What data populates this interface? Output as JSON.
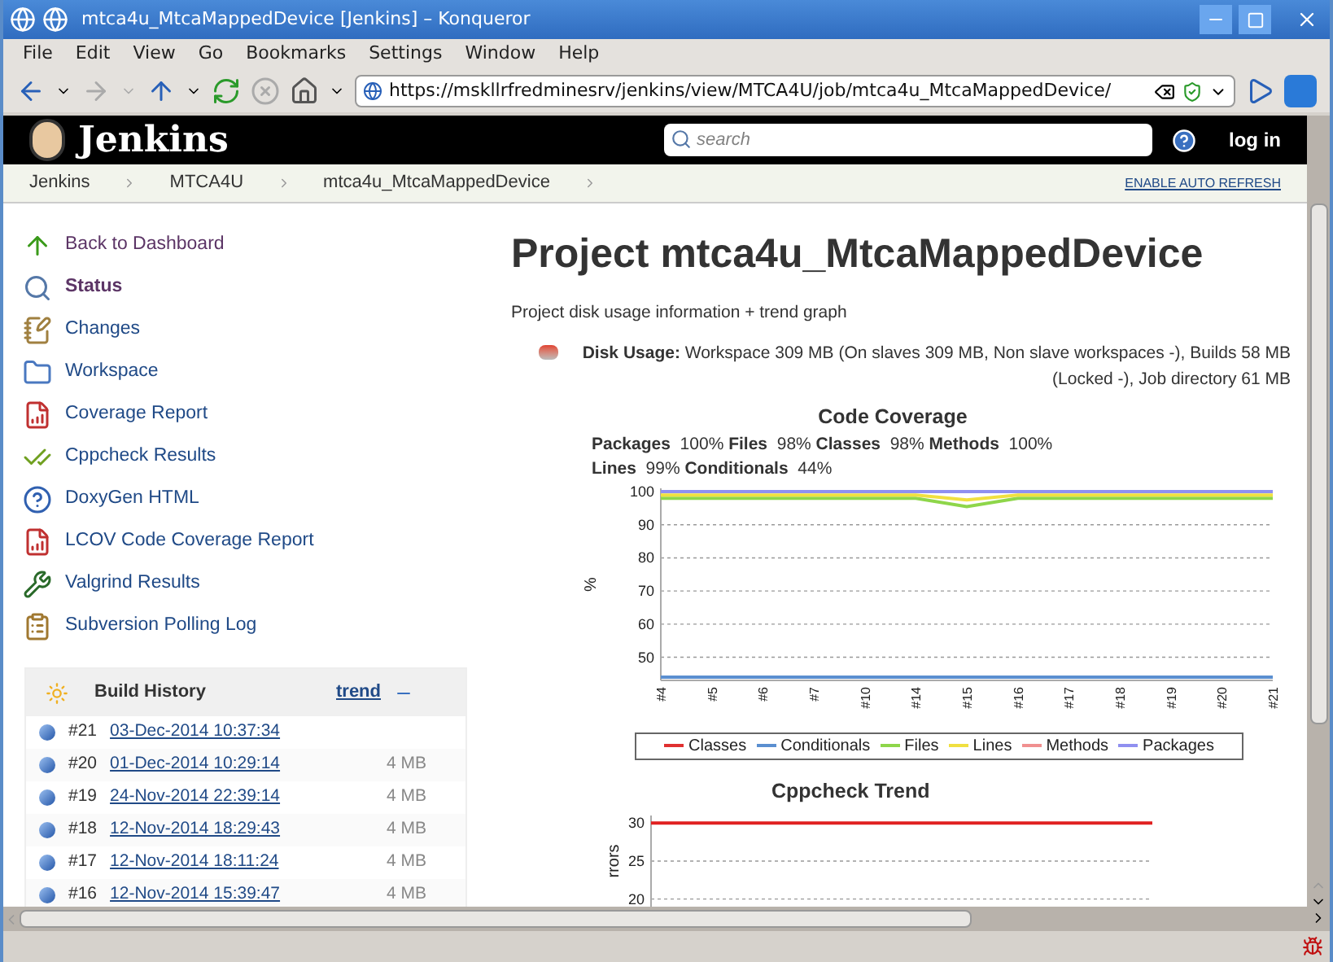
{
  "window": {
    "title": "mtca4u_MtcaMappedDevice [Jenkins] – Konqueror"
  },
  "menu": [
    "File",
    "Edit",
    "View",
    "Go",
    "Bookmarks",
    "Settings",
    "Window",
    "Help"
  ],
  "address_bar": {
    "value": "https://mskllrfredminesrv/jenkins/view/MTCA4U/job/mtca4u_MtcaMappedDevice/"
  },
  "header": {
    "logo_text": "Jenkins",
    "search": {
      "placeholder": "search"
    },
    "login": "log in"
  },
  "breadcrumbs": [
    "Jenkins",
    "MTCA4U",
    "mtca4u_MtcaMappedDevice"
  ],
  "auto_refresh": "ENABLE AUTO REFRESH",
  "sidebar": {
    "items": [
      {
        "label": "Back to Dashboard",
        "visited": true,
        "selected": false
      },
      {
        "label": "Status",
        "visited": true,
        "selected": true
      },
      {
        "label": "Changes",
        "visited": false,
        "selected": false
      },
      {
        "label": "Workspace",
        "visited": false,
        "selected": false
      },
      {
        "label": "Coverage Report",
        "visited": false,
        "selected": false
      },
      {
        "label": "Cppcheck Results",
        "visited": false,
        "selected": false
      },
      {
        "label": "DoxyGen HTML",
        "visited": false,
        "selected": false
      },
      {
        "label": "LCOV Code Coverage Report",
        "visited": false,
        "selected": false
      },
      {
        "label": "Valgrind Results",
        "visited": false,
        "selected": false
      },
      {
        "label": "Subversion Polling Log",
        "visited": false,
        "selected": false
      }
    ]
  },
  "build_history": {
    "title": "Build History",
    "trend": "trend",
    "rows": [
      {
        "number": "#21",
        "date": "03-Dec-2014 10:37:34"
      },
      {
        "number": "#20",
        "date": "01-Dec-2014 10:29:14",
        "size": "4 MB"
      },
      {
        "number": "#19",
        "date": "24-Nov-2014 22:39:14",
        "size": "4 MB"
      },
      {
        "number": "#18",
        "date": "12-Nov-2014 18:29:43",
        "size": "4 MB"
      },
      {
        "number": "#17",
        "date": "12-Nov-2014 18:11:24",
        "size": "4 MB"
      },
      {
        "number": "#16",
        "date": "12-Nov-2014 15:39:47",
        "size": "4 MB"
      }
    ]
  },
  "main": {
    "title": "Project mtca4u_MtcaMappedDevice",
    "disk_usage_caption": "Project disk usage information + trend graph",
    "disk_usage": "**Disk Usage:** Workspace 309 MB (On slaves 309 MB, Non slave workspaces -), Builds 58 MB (Locked -), Job directory 61 MB",
    "coverage_title": "Code Coverage",
    "coverage_summary": "**Packages**  100% **Files**  98% **Classes**  98% **Methods**  100% **Lines**  99% **Conditionals**  44%",
    "coverage_chart": {
      "chart_data": {
        "type": "line",
        "ylabel": "%",
        "categories": [
          "#4",
          "#5",
          "#6",
          "#7",
          "#10",
          "#14",
          "#15",
          "#16",
          "#17",
          "#18",
          "#19",
          "#20",
          "#21"
        ],
        "ylim": [
          43,
          101
        ],
        "yticks": [
          50,
          60,
          70,
          80,
          90,
          100
        ],
        "grid": true,
        "series": [
          {
            "name": "Classes",
            "color": "#e03030",
            "values": [
              null,
              null,
              null,
              null,
              null,
              null,
              null,
              null,
              null,
              null,
              null,
              null,
              null
            ]
          },
          {
            "name": "Conditionals",
            "color": "#5b8fd0",
            "values": [
              44,
              44,
              44,
              44,
              44,
              44,
              44,
              44,
              44,
              44,
              44,
              44,
              44
            ]
          },
          {
            "name": "Files",
            "color": "#8ed64a",
            "values": [
              98,
              98,
              98,
              98,
              98,
              98,
              95.5,
              98,
              98,
              98,
              98,
              98,
              98
            ]
          },
          {
            "name": "Lines",
            "color": "#f0e040",
            "values": [
              99,
              99,
              99,
              99,
              99,
              99,
              97.5,
              99,
              99,
              99,
              99,
              99,
              99
            ]
          },
          {
            "name": "Methods",
            "color": "#f09090",
            "values": [
              null,
              null,
              null,
              null,
              null,
              null,
              null,
              null,
              null,
              null,
              null,
              null,
              null
            ]
          },
          {
            "name": "Packages",
            "color": "#9090f0",
            "values": [
              100,
              100,
              100,
              100,
              100,
              100,
              100,
              100,
              100,
              100,
              100,
              100,
              100
            ]
          }
        ]
      }
    },
    "cppcheck_title": "Cppcheck Trend",
    "cppcheck_chart": {
      "chart_data": {
        "type": "line",
        "ylabel": "rrors",
        "yticks": [
          20,
          25,
          30
        ],
        "ylim": [
          19,
          31
        ],
        "grid": true,
        "series": [
          {
            "color": "#e02020",
            "values": [
              30,
              30,
              30,
              30,
              30,
              30,
              30,
              30,
              30,
              30,
              30,
              30,
              30,
              30
            ]
          }
        ]
      }
    }
  }
}
